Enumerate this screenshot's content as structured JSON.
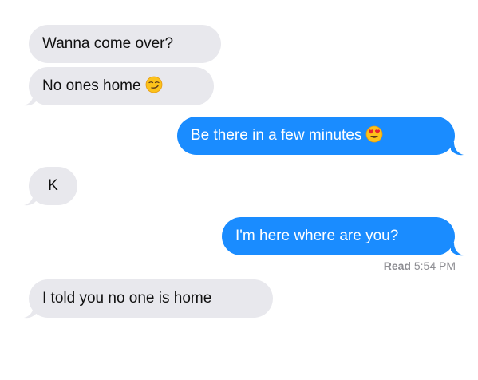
{
  "messages": [
    {
      "sender": "them",
      "text": "Wanna come over?"
    },
    {
      "sender": "them",
      "text": "No ones home",
      "emoji": "smirking-face-emoji"
    },
    {
      "sender": "me",
      "text": "Be there in a few minutes",
      "emoji": "heart-eyes-emoji"
    },
    {
      "sender": "them",
      "text": "K"
    },
    {
      "sender": "me",
      "text": "I'm here where are you?"
    },
    {
      "sender": "them",
      "text": "I told you no one is home"
    }
  ],
  "receipt": {
    "status": "Read",
    "time": "5:54 PM"
  },
  "colors": {
    "incoming_bubble": "#e8e8ed",
    "outgoing_bubble": "#1a8cff",
    "receipt_text": "#8e8e93"
  }
}
